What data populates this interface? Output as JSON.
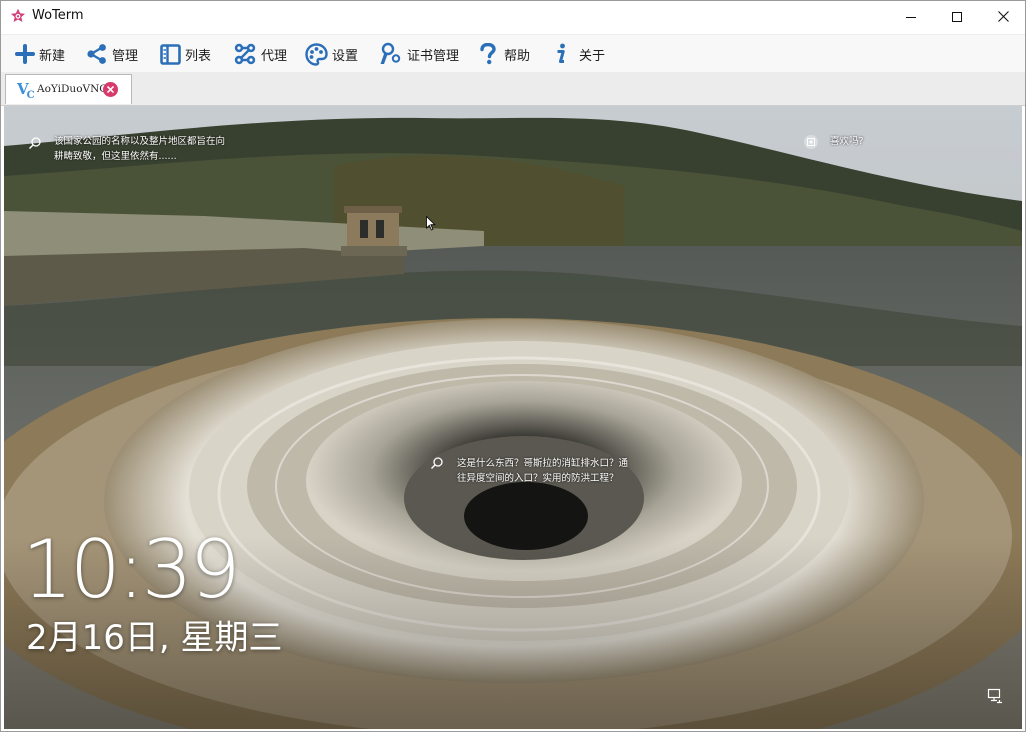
{
  "window": {
    "title": "WoTerm",
    "logo_icon": "woterm-logo-icon",
    "controls": [
      "minimize-icon",
      "maximize-icon",
      "close-icon"
    ]
  },
  "toolbar": {
    "items": [
      {
        "label": "新建",
        "icon": "plus-icon"
      },
      {
        "label": "管理",
        "icon": "share-icon"
      },
      {
        "label": "列表",
        "icon": "list-panel-icon"
      },
      {
        "label": "代理",
        "icon": "proxy-icon"
      },
      {
        "label": "设置",
        "icon": "palette-icon"
      },
      {
        "label": "证书管理",
        "icon": "key-user-icon"
      },
      {
        "label": "帮助",
        "icon": "question-icon"
      },
      {
        "label": "关于",
        "icon": "info-icon"
      }
    ]
  },
  "tabs": [
    {
      "label": "AoYiDuoVNC",
      "icon": "vnc-icon",
      "icon_text": "V",
      "icon_sub": "C",
      "active": true
    }
  ],
  "remote": {
    "tips": {
      "top_left": {
        "line1": "该国家公园的名称以及整片地区都旨在向",
        "line2": "耕畴致敬，但这里依然有......"
      },
      "top_right": {
        "text": "喜欢吗?"
      },
      "center": {
        "line1": "这是什么东西？哥斯拉的消缸排水口？通",
        "line2": "往异度空间的入口？实用的防洪工程？"
      }
    },
    "clock": {
      "time": "10:39",
      "date": "2月16日, 星期三"
    }
  },
  "colors": {
    "toolbar_icon": "#2a6fb8",
    "tab_close": "#d73a6b",
    "vnc_icon": "#3f8fd6",
    "logo": "#d0407a"
  }
}
